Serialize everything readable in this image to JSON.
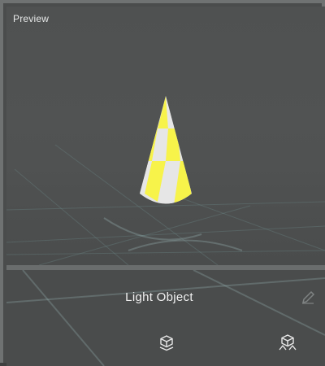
{
  "preview": {
    "title": "Preview"
  },
  "object": {
    "name": "Light Object"
  },
  "icons": {
    "edit": "pencil-icon",
    "object_mode": "cube-icon",
    "object_light": "cube-light-icon"
  },
  "colors": {
    "cone_yellow": "#f7f34a",
    "cone_white": "#e6e6e6"
  }
}
